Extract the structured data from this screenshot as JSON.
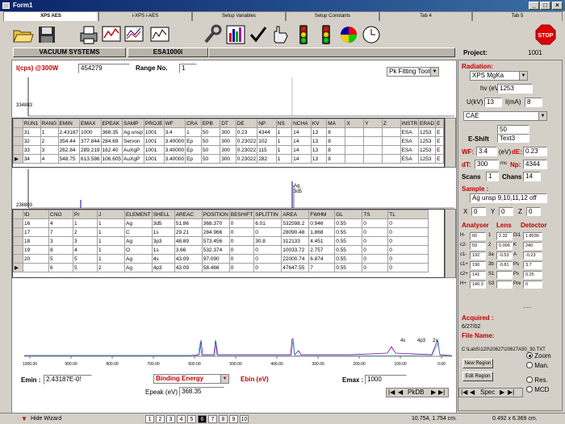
{
  "window": {
    "title": "Form1"
  },
  "tabs": [
    "XPS AES",
    "i-XPS i-AES",
    "Setup Variables",
    "Setup Constants",
    "Tab 4",
    "Tab 5"
  ],
  "header": {
    "vacuum": "VACUUM SYSTEMS",
    "instrument": "ESA1000i",
    "project_label": "Project:",
    "project_value": "1001"
  },
  "top_panel": {
    "icps_label": "I(cps) @300W",
    "icps_value": "454279",
    "range_label": "Range No.",
    "range_value": "1",
    "fit_tools": "Pk Fitting Tools",
    "y_max": "334883"
  },
  "runs_table": {
    "columns": [
      "RUN1",
      "RANG",
      "EMIN",
      "EMAX",
      "EPEAK",
      "SAMP",
      "PROJE",
      "WF",
      "CRA",
      "EPB",
      "DT",
      "DE",
      "NP",
      "NS",
      "NCHA",
      "KV",
      "MA",
      "X",
      "Y",
      "Z",
      "INSTR",
      "ERAD",
      "E"
    ],
    "rows": [
      [
        "31",
        "1",
        "2.43187",
        "1000",
        "368.35",
        "Ag unsp",
        "1001",
        "3.4",
        "1",
        "50",
        "300",
        "0.23",
        "4344",
        "1",
        "14",
        "13",
        "8",
        "",
        "",
        "",
        "ESA",
        "1253",
        "E"
      ],
      [
        "32",
        "2",
        "354.44",
        "377.844",
        "284.69",
        "Servon",
        "1001",
        "3.40000",
        "Ep",
        "50",
        "300",
        "0.23022",
        "102",
        "1",
        "14",
        "13",
        "8",
        "",
        "",
        "",
        "ESA",
        "1253",
        "E"
      ],
      [
        "33",
        "3",
        "262.84",
        "289.219",
        "162.40",
        "AuXgP",
        "1001",
        "3.40000",
        "Ep",
        "50",
        "300",
        "0.23022",
        "115",
        "1",
        "14",
        "13",
        "8",
        "",
        "",
        "",
        "ESA",
        "1253",
        "E"
      ],
      [
        "34",
        "4",
        "548.75",
        "613.586",
        "106.605",
        "AuXgP",
        "1001",
        "3.40000",
        "Ep",
        "50",
        "300",
        "0.23022",
        "282",
        "1",
        "14",
        "13",
        "8",
        "",
        "",
        "",
        "ESA",
        "1253",
        "E"
      ]
    ]
  },
  "mid_panel": {
    "y_max": "236803",
    "peak_label": "Ag",
    "peak_sub": "3d5"
  },
  "peaks_table": {
    "columns": [
      "ID",
      "CNO",
      "Pr",
      "J",
      "ELEMENT",
      "SHELL",
      "AREAC",
      "POSITION",
      "BESHIFT",
      "SPLITTIN",
      "AREA",
      "FWHM",
      "GL",
      "TS",
      "TL"
    ],
    "rows": [
      [
        "16",
        "4",
        "1",
        "1",
        "Ag",
        "3d5",
        "51.86",
        "368.370",
        "0",
        "6.01",
        "532598.2",
        "0.946",
        "0.55",
        "0",
        "0"
      ],
      [
        "17",
        "7",
        "2",
        "1",
        "C",
        "1s",
        "29.21",
        "284.966",
        "0",
        "0",
        "28090.48",
        "1.868",
        "0.55",
        "0",
        "0"
      ],
      [
        "18",
        "3",
        "3",
        "1",
        "Ag",
        "3p3",
        "48.89",
        "573.456",
        "0",
        "30.8",
        "312133",
        "4.451",
        "0.55",
        "0",
        "0"
      ],
      [
        "19",
        "8",
        "4",
        "1",
        "O",
        "1s",
        "3.66",
        "532.374",
        "0",
        "0",
        "10033.72",
        "2.757",
        "0.55",
        "0",
        "0"
      ],
      [
        "20",
        "5",
        "5",
        "1",
        "Ag",
        "4s",
        "43.09",
        "97.090",
        "0",
        "0",
        "22000.74",
        "6.874",
        "0.55",
        "0",
        "0"
      ],
      [
        "",
        "6",
        "5",
        "2",
        "Ag",
        "4p3",
        "43.09",
        "58.466",
        "0",
        "0",
        "47647.55",
        "7",
        "0.55",
        "0",
        "0"
      ]
    ]
  },
  "spectrum": {
    "ticks": [
      "1000.00",
      "900.00",
      "800.00",
      "700.00",
      "600.00",
      "500.00",
      "400.00",
      "300.00",
      "200.00",
      "100.00",
      "0.00"
    ],
    "labels": [
      "4s",
      "4p3",
      "2s"
    ]
  },
  "bottom": {
    "emin_label": "Emin :",
    "emin_value": "2.43187E-0!",
    "mode": "Binding Energy",
    "ebin_label": "Ebin  (eV)",
    "emax_label": "Emax :",
    "emax_value": "1000",
    "epeak_label": "Epeak (eV)",
    "epeak_value": "368.35",
    "nav_label": "PkDB"
  },
  "right": {
    "radiation_label": "Radiation:",
    "radiation_value": "XPS MgKa",
    "hv_label": "hv (eV)",
    "hv_value": "1253",
    "u_label": "U(kV)",
    "u_value": "13",
    "i_label": "I(mA)",
    "i_value": "8",
    "analyser": "CAE",
    "eshift_value": "50",
    "eshift_label": "E-Shift",
    "eshift_text": "Text3",
    "wf_label": "WF:",
    "wf_value": "3.4",
    "de_label": "dE:",
    "de_value": "0.23",
    "ev_unit": "(eV)",
    "dt_label": "dT:",
    "dt_value": "300",
    "ms_unit": "ms",
    "np_label": "Np:",
    "np_value": "4344",
    "scans_label": "Scans",
    "scans_value": "1",
    "chans_label": "Chans",
    "chans_value": "14",
    "sample_label": "Sample :",
    "sample_value": "Ag unsp 9,10,11,12 off",
    "x_label": "X",
    "x_value": "0",
    "y_label": "Y",
    "y_value": "0",
    "z_label": "Z",
    "z_value": "0",
    "h_analyser": "Analyser",
    "h_lens": "Lens",
    "h_detector": "Detector",
    "params": [
      [
        "H-",
        "60",
        "1",
        "2.32",
        "Di1",
        "1.8030"
      ],
      [
        "c2-",
        "59",
        "2",
        "0.006",
        "K",
        "240"
      ],
      [
        "c1-",
        "192",
        "3a",
        "-0.53",
        "A",
        "-0.23"
      ],
      [
        "c1+",
        "190",
        "3b",
        "-0.81",
        "Ps",
        "3.7"
      ],
      [
        "c2+",
        "141",
        "S1",
        "",
        "Ps",
        "0.25"
      ],
      [
        "H+",
        "140.3",
        "S3",
        "",
        "Pre",
        "0"
      ]
    ],
    "acquired_label": "Acquired :",
    "acquired_value": "6/27/02",
    "filename_label": "File Name:",
    "filename_value": "C:\\LabS\\120\\20627\\20627A50_30.TXT",
    "new_region": "New Region",
    "edit_region": "Edit Region",
    "opt_zoom": "Zoom",
    "opt_man": "Man.",
    "opt_res": "Res.",
    "opt_mcd": "MCD",
    "nav_spec": "Spec"
  },
  "status": {
    "hide_wizard": "Hide Wizard",
    "pages": [
      "1",
      "2",
      "3",
      "4",
      "5",
      "6",
      "7",
      "8",
      "9",
      "10"
    ],
    "active_page": "6",
    "coords1": "10.754, 1.754 cm.",
    "coords2": "0.492 x 6.369 cm."
  }
}
